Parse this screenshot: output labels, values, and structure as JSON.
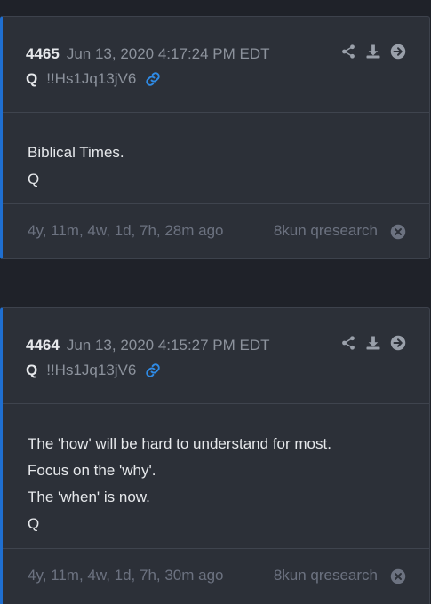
{
  "posts": [
    {
      "number": "4465",
      "timestamp": "Jun 13, 2020 4:17:24 PM EDT",
      "author": "Q",
      "tripcode": "!!Hs1Jq13jV6",
      "body": [
        "Biblical Times.",
        "Q"
      ],
      "ago": "4y, 11m, 4w, 1d, 7h, 28m ago",
      "source": "8kun qresearch"
    },
    {
      "number": "4464",
      "timestamp": "Jun 13, 2020 4:15:27 PM EDT",
      "author": "Q",
      "tripcode": "!!Hs1Jq13jV6",
      "body": [
        "The 'how' will be hard to understand for most.",
        "Focus on the 'why'.",
        "The 'when' is now.",
        "Q"
      ],
      "ago": "4y, 11m, 4w, 1d, 7h, 30m ago",
      "source": "8kun qresearch"
    }
  ],
  "icons": {
    "share": "share-icon",
    "download": "download-icon",
    "open": "arrow-right-circle-icon",
    "link": "link-icon",
    "close": "close-circle-icon"
  },
  "colors": {
    "accent": "#1f6fd1",
    "card_background": "#2c3038",
    "page_background": "#1f2229",
    "text_primary": "#e6e8eb",
    "text_muted": "#8c929c",
    "icon_muted": "#9aa0aa"
  }
}
